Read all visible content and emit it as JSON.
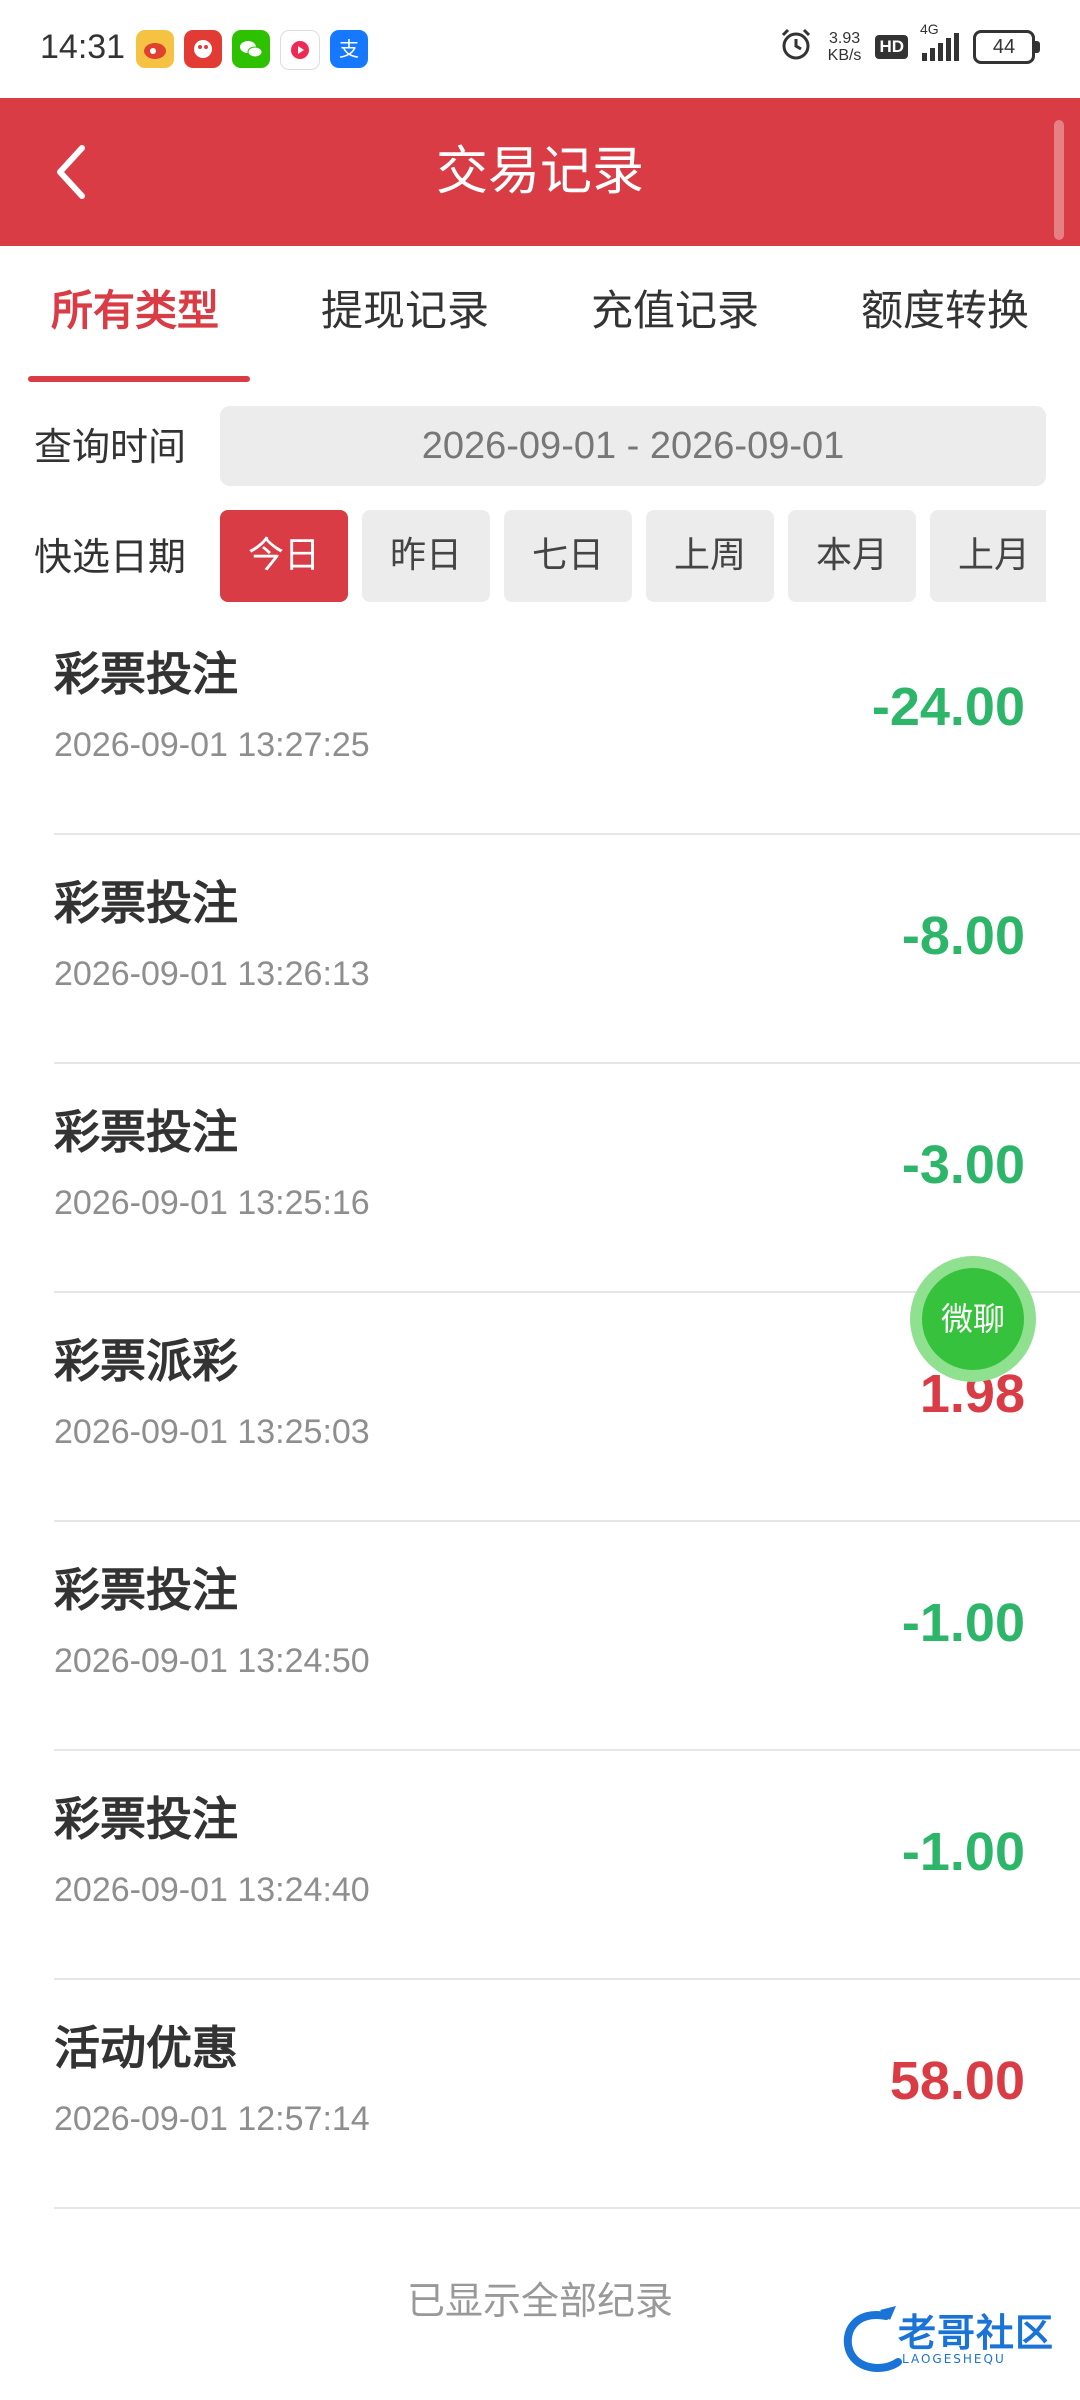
{
  "status_bar": {
    "time": "14:31",
    "app_icons": [
      "weibo-icon",
      "pdd-icon",
      "wechat-icon",
      "video-icon",
      "alipay-icon"
    ],
    "net_speed_value": "3.93",
    "net_speed_unit": "KB/s",
    "hd_label": "HD",
    "network": "4G",
    "battery": "44"
  },
  "header": {
    "title": "交易记录",
    "background_color": "#d93c44"
  },
  "tabs": [
    {
      "label": "所有类型",
      "active": true
    },
    {
      "label": "提现记录",
      "active": false
    },
    {
      "label": "充值记录",
      "active": false
    },
    {
      "label": "额度转换",
      "active": false
    }
  ],
  "filters": {
    "query_time_label": "查询时间",
    "date_range": "2026-09-01 - 2026-09-01",
    "quick_date_label": "快选日期",
    "quick_options": [
      {
        "label": "今日",
        "active": true
      },
      {
        "label": "昨日",
        "active": false
      },
      {
        "label": "七日",
        "active": false
      },
      {
        "label": "上周",
        "active": false
      },
      {
        "label": "本月",
        "active": false
      },
      {
        "label": "上月",
        "active": false
      }
    ]
  },
  "records": [
    {
      "title": "彩票投注",
      "time": "2026-09-01 13:27:25",
      "amount": "-24.00"
    },
    {
      "title": "彩票投注",
      "time": "2026-09-01 13:26:13",
      "amount": "-8.00"
    },
    {
      "title": "彩票投注",
      "time": "2026-09-01 13:25:16",
      "amount": "-3.00"
    },
    {
      "title": "彩票派彩",
      "time": "2026-09-01 13:25:03",
      "amount": "1.98"
    },
    {
      "title": "彩票投注",
      "time": "2026-09-01 13:24:50",
      "amount": "-1.00"
    },
    {
      "title": "彩票投注",
      "time": "2026-09-01 13:24:40",
      "amount": "-1.00"
    },
    {
      "title": "活动优惠",
      "time": "2026-09-01 12:57:14",
      "amount": "58.00"
    }
  ],
  "footer": {
    "end_text": "已显示全部纪录"
  },
  "floating_button": {
    "label": "微聊"
  },
  "watermark": {
    "text": "老哥社区",
    "subtext": "LAOGESHEQU"
  },
  "colors": {
    "accent": "#d93c44",
    "negative_amount": "#2db56a",
    "positive_amount": "#d93c44",
    "chat_button": "#37c23d"
  }
}
